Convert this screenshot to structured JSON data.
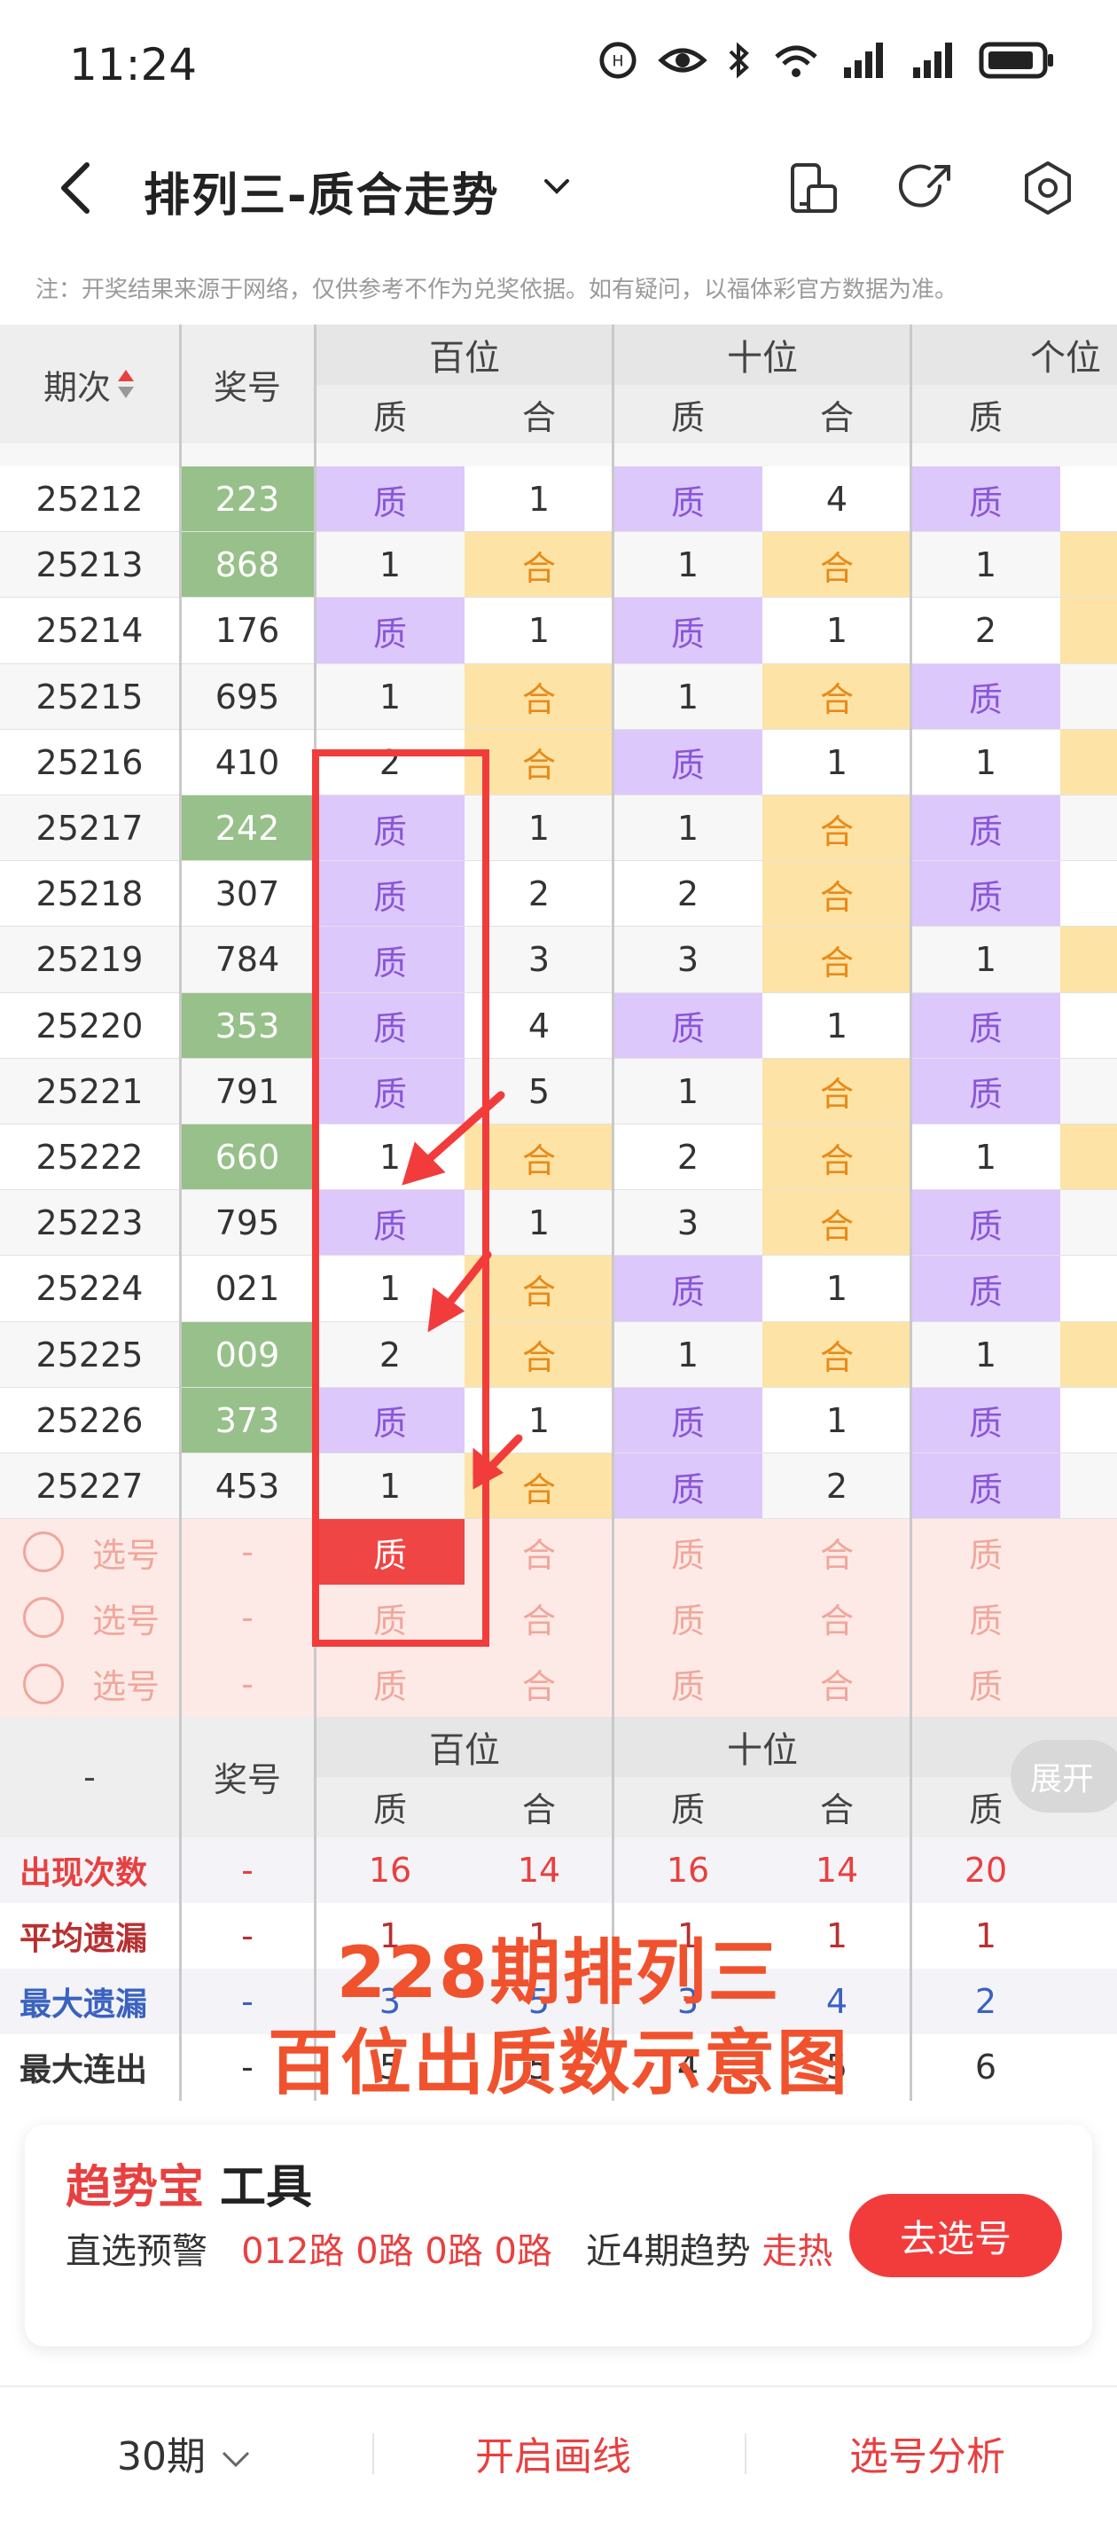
{
  "status": {
    "time": "11:24"
  },
  "nav": {
    "title": "排列三-质合走势"
  },
  "notice": "注：开奖结果来源于网络，仅供参考不作为兑奖依据。如有疑问，以福体彩官方数据为准。",
  "table": {
    "col_issue": "期次",
    "col_number": "奖号",
    "groups": [
      "百位",
      "十位",
      "个位"
    ],
    "sub": [
      "质",
      "合"
    ],
    "rows": [
      {
        "issue": "25212",
        "num": "223",
        "green": true,
        "c": [
          "质",
          "1",
          "质",
          "4",
          "质"
        ]
      },
      {
        "issue": "25213",
        "num": "868",
        "green": true,
        "c": [
          "1",
          "合",
          "1",
          "合",
          "1"
        ]
      },
      {
        "issue": "25214",
        "num": "176",
        "green": false,
        "c": [
          "质",
          "1",
          "质",
          "1",
          "2"
        ]
      },
      {
        "issue": "25215",
        "num": "695",
        "green": false,
        "c": [
          "1",
          "合",
          "1",
          "合",
          "质"
        ]
      },
      {
        "issue": "25216",
        "num": "410",
        "green": false,
        "c": [
          "2",
          "合",
          "质",
          "1",
          "1"
        ]
      },
      {
        "issue": "25217",
        "num": "242",
        "green": true,
        "c": [
          "质",
          "1",
          "1",
          "合",
          "质"
        ]
      },
      {
        "issue": "25218",
        "num": "307",
        "green": false,
        "c": [
          "质",
          "2",
          "2",
          "合",
          "质"
        ]
      },
      {
        "issue": "25219",
        "num": "784",
        "green": false,
        "c": [
          "质",
          "3",
          "3",
          "合",
          "1"
        ]
      },
      {
        "issue": "25220",
        "num": "353",
        "green": true,
        "c": [
          "质",
          "4",
          "质",
          "1",
          "质"
        ]
      },
      {
        "issue": "25221",
        "num": "791",
        "green": false,
        "c": [
          "质",
          "5",
          "1",
          "合",
          "质"
        ]
      },
      {
        "issue": "25222",
        "num": "660",
        "green": true,
        "c": [
          "1",
          "合",
          "2",
          "合",
          "1"
        ]
      },
      {
        "issue": "25223",
        "num": "795",
        "green": false,
        "c": [
          "质",
          "1",
          "3",
          "合",
          "质"
        ]
      },
      {
        "issue": "25224",
        "num": "021",
        "green": false,
        "c": [
          "1",
          "合",
          "质",
          "1",
          "质"
        ]
      },
      {
        "issue": "25225",
        "num": "009",
        "green": true,
        "c": [
          "2",
          "合",
          "1",
          "合",
          "1"
        ]
      },
      {
        "issue": "25226",
        "num": "373",
        "green": true,
        "c": [
          "质",
          "1",
          "质",
          "1",
          "质"
        ]
      },
      {
        "issue": "25227",
        "num": "453",
        "green": false,
        "c": [
          "1",
          "合",
          "质",
          "2",
          "质"
        ]
      }
    ],
    "select_label": "选号",
    "select_dash": "-"
  },
  "stats": {
    "dash": "-",
    "labels": [
      "出现次数",
      "平均遗漏",
      "最大遗漏",
      "最大连出"
    ],
    "label_colors": [
      "#e84040",
      "#b83030",
      "#3a62c0",
      "#333333"
    ],
    "values": [
      [
        "16",
        "14",
        "16",
        "14",
        "20"
      ],
      [
        "1",
        "1",
        "1",
        "1",
        "1"
      ],
      [
        "3",
        "5",
        "3",
        "4",
        "2"
      ],
      [
        "5",
        "5",
        "4",
        "5",
        "6"
      ]
    ],
    "expand_label": "展开"
  },
  "annotation": {
    "line1": "228期排列三",
    "line2": "百位出质数示意图"
  },
  "card": {
    "title_red": "趋势宝",
    "title_black": "工具",
    "line_prefix": "直选预警",
    "line_red": "012路 0路 0路 0路",
    "line_mid": "近4期趋势",
    "line_tail": "走热",
    "button": "去选号"
  },
  "bottom": {
    "period": "30期",
    "draw": "开启画线",
    "analysis": "选号分析"
  }
}
